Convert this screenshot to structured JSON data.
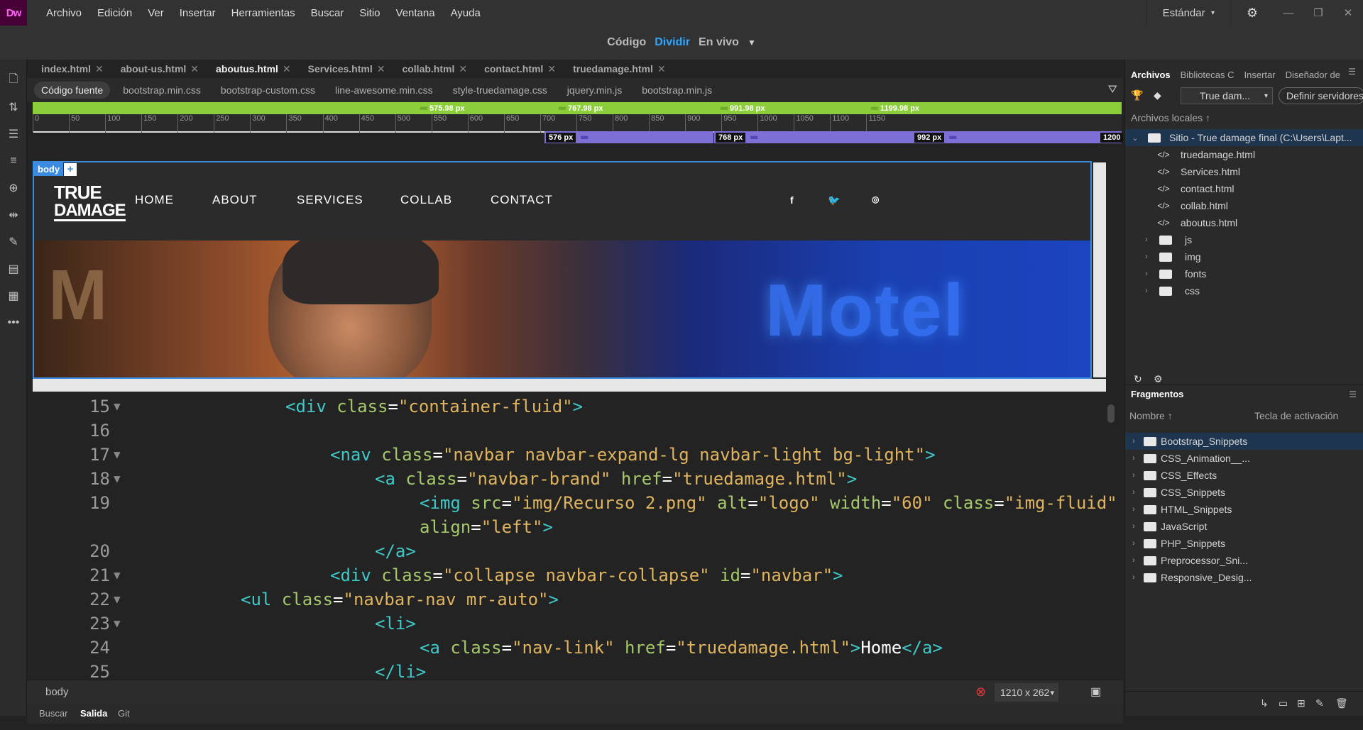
{
  "app": {
    "logo": "Dw",
    "menu": [
      "Archivo",
      "Edición",
      "Ver",
      "Insertar",
      "Herramientas",
      "Buscar",
      "Sitio",
      "Ventana",
      "Ayuda"
    ],
    "workspace": "Estándar"
  },
  "view_modes": {
    "code": "Código",
    "split": "Dividir",
    "live": "En vivo",
    "active": "Dividir"
  },
  "doc_tabs": [
    {
      "label": "index.html",
      "active": false
    },
    {
      "label": "about-us.html",
      "active": false
    },
    {
      "label": "aboutus.html",
      "active": true
    },
    {
      "label": "Services.html",
      "active": false
    },
    {
      "label": "collab.html",
      "active": false
    },
    {
      "label": "contact.html",
      "active": false
    },
    {
      "label": "truedamage.html",
      "active": false
    }
  ],
  "related_files": [
    "Código fuente",
    "bootstrap.min.css",
    "bootstrap-custom.css",
    "line-awesome.min.css",
    "style-truedamage.css",
    "jquery.min.js",
    "bootstrap.min.js"
  ],
  "media_queries": {
    "max": [
      "575.98 px",
      "767.98 px",
      "991.98 px",
      "1199.98 px"
    ],
    "min": [
      "576 px",
      "768 px",
      "992 px",
      "1200"
    ]
  },
  "ruler_ticks": [
    "0",
    "50",
    "100",
    "150",
    "200",
    "250",
    "300",
    "350",
    "400",
    "450",
    "500",
    "550",
    "600",
    "650",
    "700",
    "750",
    "800",
    "850",
    "900",
    "950",
    "1000",
    "1050",
    "1100",
    "1150"
  ],
  "live_view": {
    "tag": "body",
    "plus": "+",
    "brand_line1": "TRUE",
    "brand_line2": "DAMAGE",
    "nav": [
      "HOME",
      "ABOUT",
      "SERVICES",
      "COLLAB",
      "CONTACT"
    ],
    "social": [
      "f",
      "t",
      "ig"
    ],
    "hero_sign": "Motel",
    "hero_left": "M"
  },
  "code_lines": [
    {
      "n": "15",
      "fold": true,
      "indent": 3,
      "parts": [
        [
          "tg",
          "<div "
        ],
        [
          "at",
          "class"
        ],
        [
          "pl",
          "="
        ],
        [
          "st",
          "\"container-fluid\""
        ],
        [
          "tg",
          ">"
        ]
      ]
    },
    {
      "n": "16",
      "fold": false,
      "indent": 0,
      "parts": []
    },
    {
      "n": "17",
      "fold": true,
      "indent": 4,
      "parts": [
        [
          "tg",
          "<nav "
        ],
        [
          "at",
          "class"
        ],
        [
          "pl",
          "="
        ],
        [
          "st",
          "\"navbar navbar-expand-lg navbar-light bg-light\""
        ],
        [
          "tg",
          ">"
        ]
      ]
    },
    {
      "n": "18",
      "fold": true,
      "indent": 5,
      "parts": [
        [
          "tg",
          "<a "
        ],
        [
          "at",
          "class"
        ],
        [
          "pl",
          "="
        ],
        [
          "st",
          "\"navbar-brand\""
        ],
        [
          "pl",
          " "
        ],
        [
          "at",
          "href"
        ],
        [
          "pl",
          "="
        ],
        [
          "st",
          "\"truedamage.html\""
        ],
        [
          "tg",
          ">"
        ]
      ]
    },
    {
      "n": "19",
      "fold": false,
      "indent": 6,
      "parts": [
        [
          "tg",
          "<img "
        ],
        [
          "at",
          "src"
        ],
        [
          "pl",
          "="
        ],
        [
          "st",
          "\"img/Recurso 2.png\""
        ],
        [
          "pl",
          " "
        ],
        [
          "at",
          "alt"
        ],
        [
          "pl",
          "="
        ],
        [
          "st",
          "\"logo\""
        ],
        [
          "pl",
          " "
        ],
        [
          "at",
          "width"
        ],
        [
          "pl",
          "="
        ],
        [
          "st",
          "\"60\""
        ],
        [
          "pl",
          " "
        ],
        [
          "at",
          "class"
        ],
        [
          "pl",
          "="
        ],
        [
          "st",
          "\"img-fluid\""
        ]
      ]
    },
    {
      "n": "",
      "fold": false,
      "indent": 6,
      "parts": [
        [
          "at",
          "align"
        ],
        [
          "pl",
          "="
        ],
        [
          "st",
          "\"left\""
        ],
        [
          "tg",
          ">"
        ]
      ]
    },
    {
      "n": "20",
      "fold": false,
      "indent": 5,
      "parts": [
        [
          "tg",
          "</a>"
        ]
      ]
    },
    {
      "n": "21",
      "fold": true,
      "indent": 4,
      "parts": [
        [
          "tg",
          "<div "
        ],
        [
          "at",
          "class"
        ],
        [
          "pl",
          "="
        ],
        [
          "st",
          "\"collapse navbar-collapse\""
        ],
        [
          "pl",
          " "
        ],
        [
          "at",
          "id"
        ],
        [
          "pl",
          "="
        ],
        [
          "st",
          "\"navbar\""
        ],
        [
          "tg",
          ">"
        ]
      ]
    },
    {
      "n": "22",
      "fold": true,
      "indent": 2,
      "parts": [
        [
          "tg",
          "<ul "
        ],
        [
          "at",
          "class"
        ],
        [
          "pl",
          "="
        ],
        [
          "st",
          "\"navbar-nav mr-auto\""
        ],
        [
          "tg",
          ">"
        ]
      ]
    },
    {
      "n": "23",
      "fold": true,
      "indent": 5,
      "parts": [
        [
          "tg",
          "<li>"
        ]
      ]
    },
    {
      "n": "24",
      "fold": false,
      "indent": 6,
      "parts": [
        [
          "tg",
          "<a "
        ],
        [
          "at",
          "class"
        ],
        [
          "pl",
          "="
        ],
        [
          "st",
          "\"nav-link\""
        ],
        [
          "pl",
          " "
        ],
        [
          "at",
          "href"
        ],
        [
          "pl",
          "="
        ],
        [
          "st",
          "\"truedamage.html\""
        ],
        [
          "tg",
          ">"
        ],
        [
          "pl",
          "Home"
        ],
        [
          "tg",
          "</a>"
        ]
      ]
    },
    {
      "n": "25",
      "fold": false,
      "indent": 5,
      "parts": [
        [
          "tg",
          "</li>"
        ]
      ]
    }
  ],
  "status_bar": {
    "tag": "body",
    "size": "1210 x 262"
  },
  "bottom_tabs": [
    {
      "label": "Buscar",
      "active": false
    },
    {
      "label": "Salida",
      "active": true
    },
    {
      "label": "Git",
      "active": false
    }
  ],
  "files_panel": {
    "tabs": [
      "Archivos",
      "Bibliotecas C",
      "Insertar",
      "Diseñador de"
    ],
    "site": "True dam...",
    "define_servers": "Definir servidores",
    "local_header": "Archivos locales",
    "root": "Sitio - True damage final (C:\\Users\\Lapt...",
    "files": [
      "truedamage.html",
      "Services.html",
      "contact.html",
      "collab.html",
      "aboutus.html"
    ],
    "folders": [
      "js",
      "img",
      "fonts",
      "css"
    ]
  },
  "snippets_panel": {
    "title": "Fragmentos",
    "col_name": "Nombre",
    "col_key": "Tecla de activación",
    "items": [
      "Bootstrap_Snippets",
      "CSS_Animation__...",
      "CSS_Effects",
      "CSS_Snippets",
      "HTML_Snippets",
      "JavaScript",
      "PHP_Snippets",
      "Preprocessor_Sni...",
      "Responsive_Desig..."
    ]
  }
}
